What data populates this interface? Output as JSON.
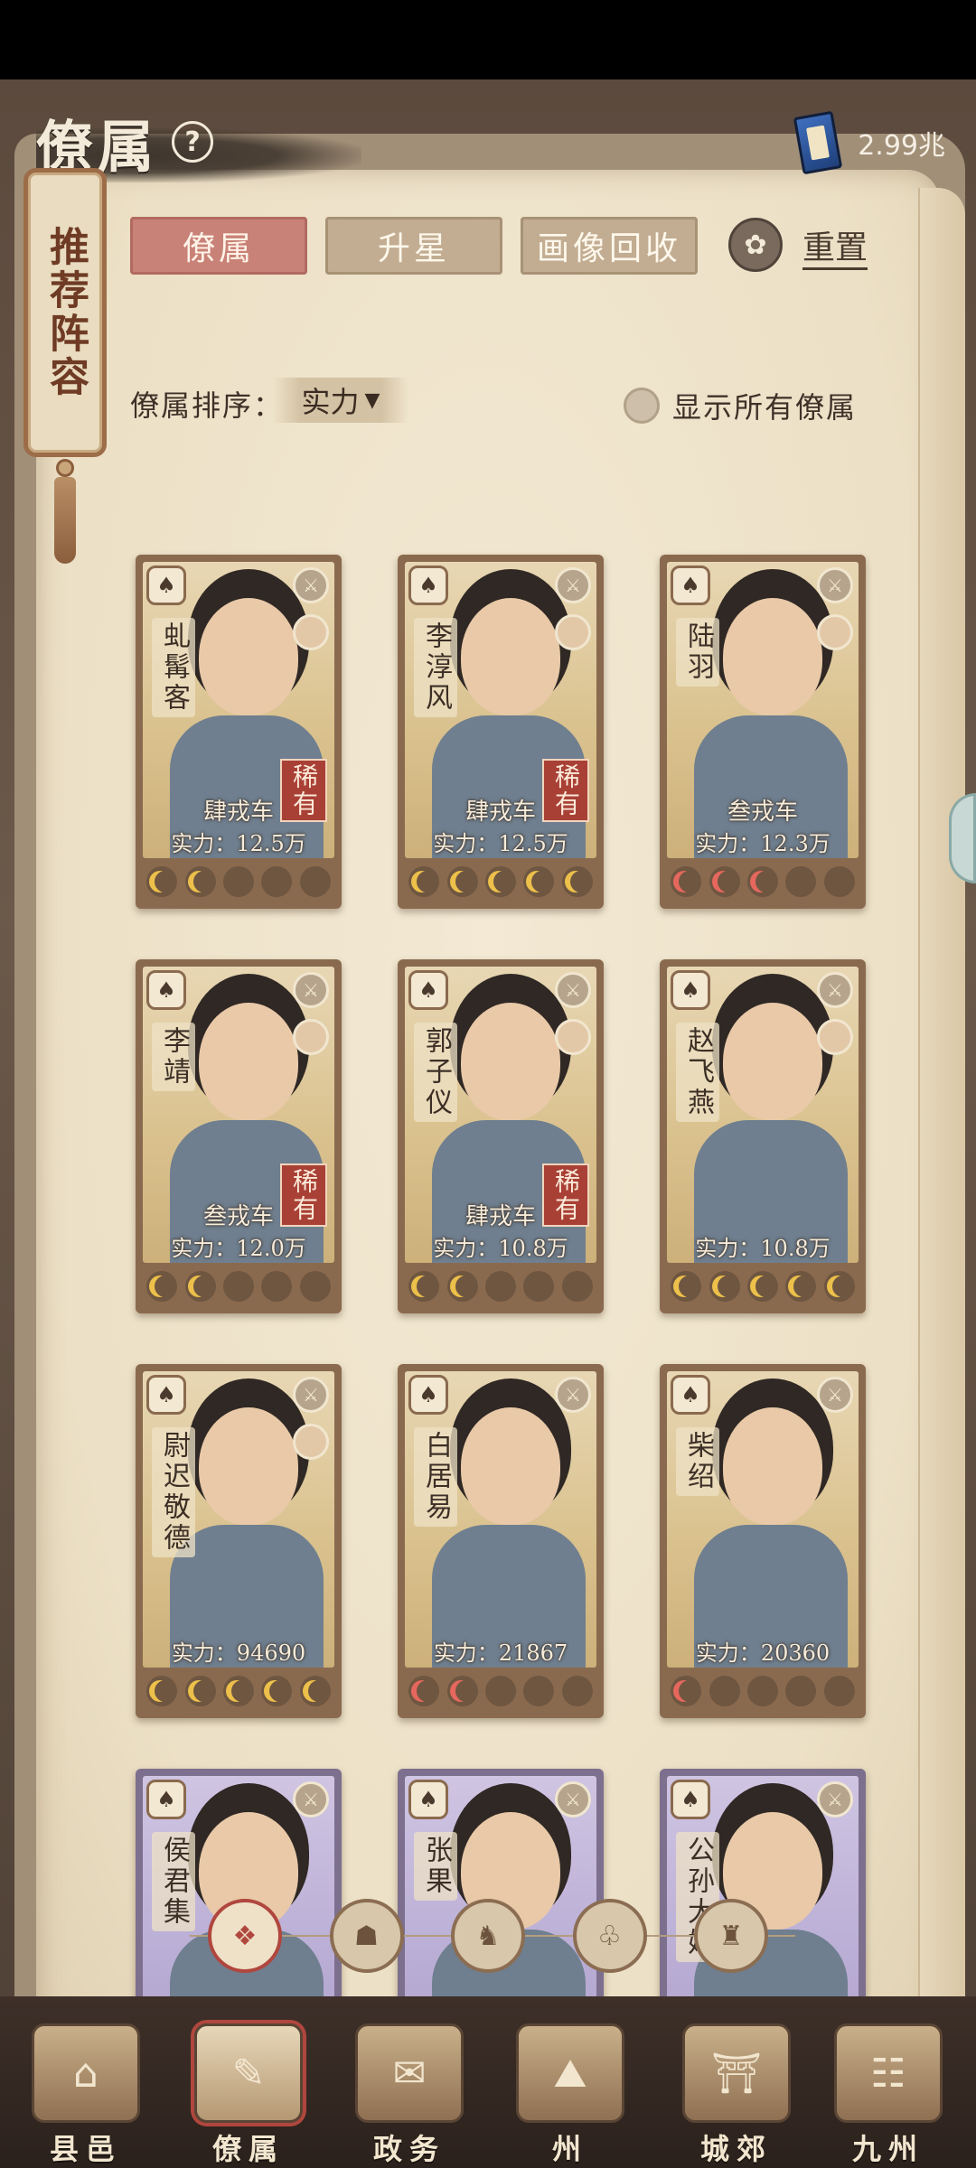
{
  "header": {
    "title": "僚属",
    "help_glyph": "?",
    "currency_amount": "2.99兆"
  },
  "side_scroll": {
    "label": "推荐阵容"
  },
  "tabs": [
    {
      "label": "僚属",
      "active": true
    },
    {
      "label": "升星",
      "active": false
    },
    {
      "label": "画像回收",
      "active": false
    }
  ],
  "reset_label": "重置",
  "sort": {
    "label": "僚属排序：",
    "value": "实力",
    "caret": "▼"
  },
  "show_all_label": "显示所有僚属",
  "colors": {
    "gold_star": "#ecc04a",
    "red_star": "#e5675d",
    "rare_tag": "#a94036"
  },
  "cards": [
    {
      "name": "虬髯客",
      "rarity": "稀有",
      "grade": "肆戎车",
      "power": "实力：12.5万",
      "stars": [
        "gold",
        "gold",
        "empty",
        "empty",
        "empty"
      ]
    },
    {
      "name": "李淳风",
      "rarity": "稀有",
      "grade": "肆戎车",
      "power": "实力：12.5万",
      "stars": [
        "gold",
        "gold",
        "gold",
        "gold",
        "gold"
      ]
    },
    {
      "name": "陆羽",
      "rarity": "",
      "grade": "叁戎车",
      "power": "实力：12.3万",
      "stars": [
        "red",
        "red",
        "red",
        "empty",
        "empty"
      ]
    },
    {
      "name": "李靖",
      "rarity": "稀有",
      "grade": "叁戎车",
      "power": "实力：12.0万",
      "stars": [
        "gold",
        "gold",
        "empty",
        "empty",
        "empty"
      ]
    },
    {
      "name": "郭子仪",
      "rarity": "稀有",
      "grade": "肆戎车",
      "power": "实力：10.8万",
      "stars": [
        "gold",
        "gold",
        "empty",
        "empty",
        "empty"
      ]
    },
    {
      "name": "赵飞燕",
      "rarity": "",
      "grade": "",
      "power": "实力：10.8万",
      "stars": [
        "gold",
        "gold",
        "gold",
        "gold",
        "gold"
      ]
    },
    {
      "name": "尉迟敬德",
      "rarity": "",
      "grade": "",
      "power": "实力：94690",
      "stars": [
        "gold",
        "gold",
        "gold",
        "gold",
        "gold"
      ]
    },
    {
      "name": "白居易",
      "rarity": "",
      "grade": "",
      "power": "实力：21867",
      "stars": [
        "red",
        "red",
        "empty",
        "empty",
        "empty"
      ]
    },
    {
      "name": "柴绍",
      "rarity": "",
      "grade": "",
      "power": "实力：20360",
      "stars": [
        "red",
        "empty",
        "empty",
        "empty",
        "empty"
      ]
    },
    {
      "name": "侯君集",
      "rarity": "",
      "grade": "",
      "power": "",
      "stars": []
    },
    {
      "name": "张果",
      "rarity": "",
      "grade": "",
      "power": "",
      "stars": []
    },
    {
      "name": "公孙大娘",
      "rarity": "",
      "grade": "",
      "power": "",
      "stars": []
    }
  ],
  "camp_filters": [
    "all-icon",
    "camp-1-icon",
    "camp-2-icon",
    "camp-3-icon",
    "camp-4-icon"
  ],
  "bottom_nav": [
    {
      "label": "县邑",
      "icon": "town-icon"
    },
    {
      "label": "僚属",
      "icon": "retainer-icon",
      "active": true
    },
    {
      "label": "政务",
      "icon": "affairs-icon"
    },
    {
      "label": "州",
      "icon": "prefecture-icon"
    },
    {
      "label": "城郊",
      "icon": "suburb-icon"
    },
    {
      "label": "九州",
      "icon": "nine-provinces-icon"
    }
  ]
}
